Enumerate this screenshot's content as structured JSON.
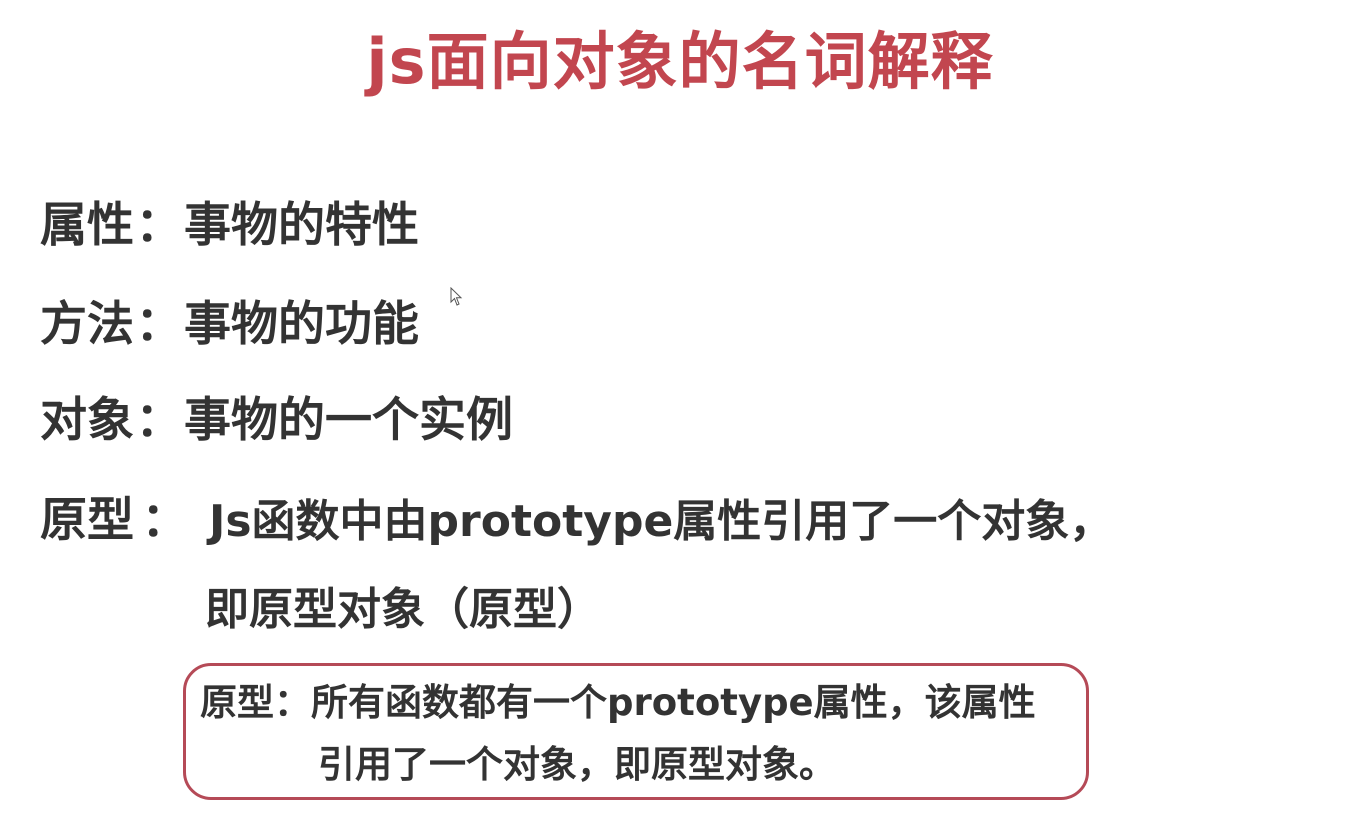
{
  "title": "js面向对象的名词解释",
  "terms": [
    {
      "term": "属性",
      "colon": "：",
      "desc": "事物的特性"
    },
    {
      "term": "方法",
      "colon": "：",
      "desc": "事物的功能"
    },
    {
      "term": "对象",
      "colon": "：",
      "desc": "事物的一个实例"
    },
    {
      "term": "原型",
      "colon": "：",
      "desc": "Js函数中由prototype属性引用了一个对象，",
      "desc_cont": "即原型对象（原型）"
    }
  ],
  "note": {
    "line1": "原型：所有函数都有一个prototype属性，该属性",
    "line2": "引用了一个对象，即原型对象。",
    "border_color": "#b54a57"
  },
  "colors": {
    "title": "#c2464f",
    "text": "#333333"
  },
  "cursor": "mouse-pointer-icon"
}
